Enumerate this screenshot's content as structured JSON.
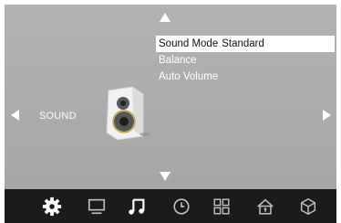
{
  "nav": {
    "up_icon": "arrow-up-icon",
    "down_icon": "arrow-down-icon",
    "left_icon": "arrow-left-icon",
    "right_icon": "arrow-right-icon"
  },
  "section": {
    "label": "SOUND",
    "icon": "speaker-icon"
  },
  "menu": {
    "items": [
      {
        "label": "Sound Mode",
        "value": "Standard",
        "selected": true
      },
      {
        "label": "Balance",
        "value": "",
        "selected": false
      },
      {
        "label": "Auto Volume",
        "value": "",
        "selected": false
      }
    ]
  },
  "tabs": [
    {
      "icon": "gear-icon",
      "active": false
    },
    {
      "icon": "monitor-icon",
      "active": false
    },
    {
      "icon": "music-note-icon",
      "active": true
    },
    {
      "icon": "clock-icon",
      "active": false
    },
    {
      "icon": "grid-icon",
      "active": false
    },
    {
      "icon": "lock-icon",
      "active": false
    },
    {
      "icon": "cube-icon",
      "active": false
    }
  ],
  "colors": {
    "panel": "#aaaaaa",
    "bar": "#1b1b1b",
    "highlight": "#ffffff",
    "text": "#ffffff"
  }
}
